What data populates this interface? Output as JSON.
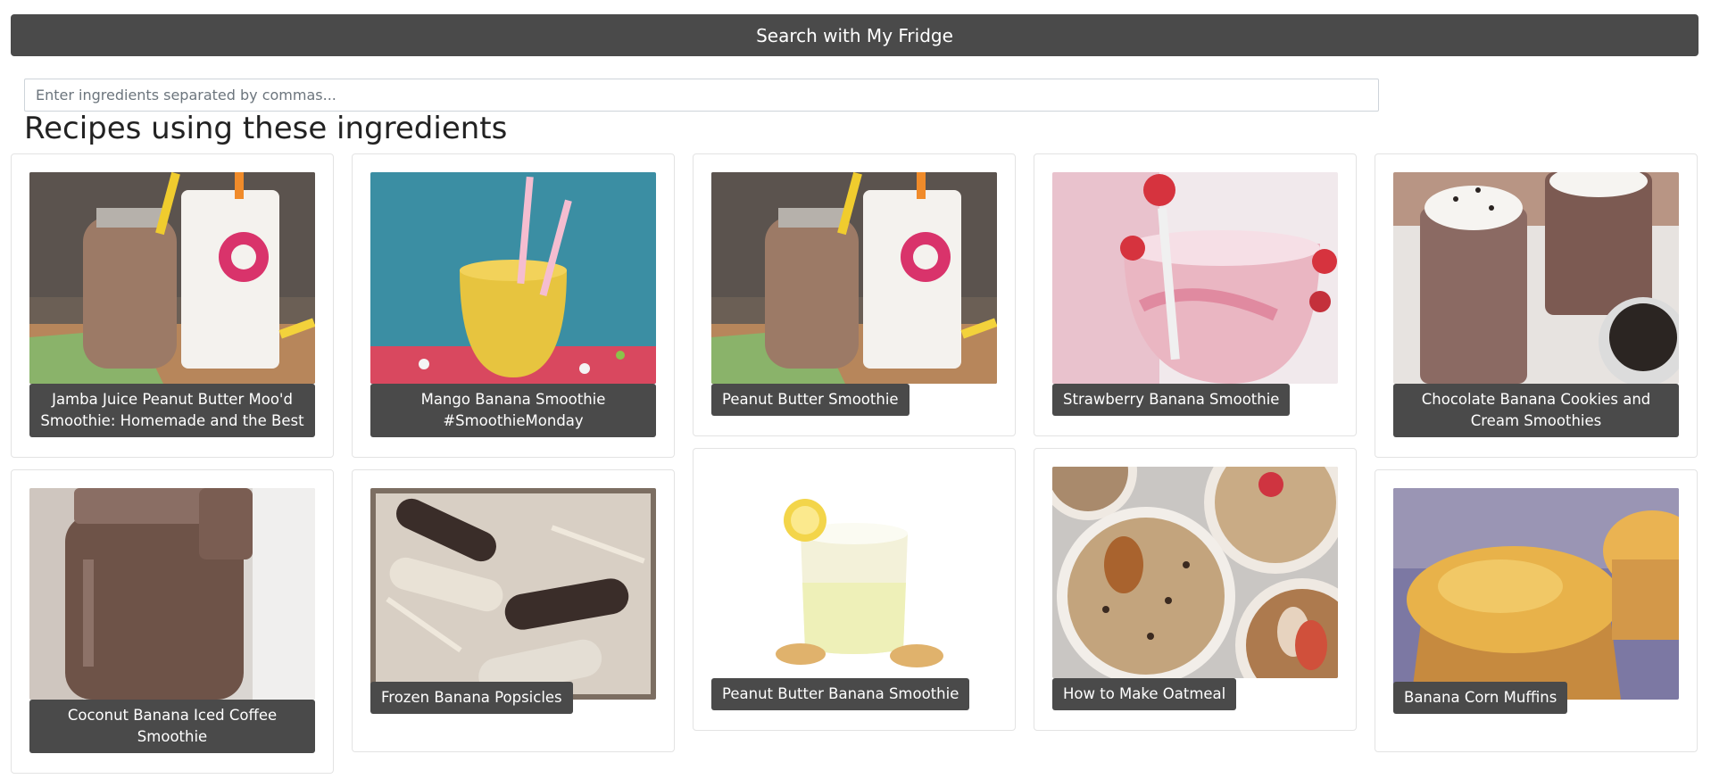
{
  "search_button_label": "Search with My Fridge",
  "ingredients_input": {
    "placeholder": "Enter ingredients separated by commas...",
    "value": ""
  },
  "section_title": "Recipes using these ingredients",
  "recipes": [
    {
      "title": "Jamba Juice Peanut Butter Moo'd Smoothie: Homemade and the Best",
      "image": "chocolate-smoothie-with-jamba-cups"
    },
    {
      "title": "Mango Banana Smoothie #SmoothieMonday",
      "image": "yellow-smoothie-with-pink-straws"
    },
    {
      "title": "Peanut Butter Smoothie",
      "image": "chocolate-smoothie-with-jamba-cups"
    },
    {
      "title": "Strawberry Banana Smoothie",
      "image": "pink-smoothie-with-strawberries"
    },
    {
      "title": "Chocolate Banana Cookies and Cream Smoothies",
      "image": "chocolate-smoothie-with-whipped-cream"
    },
    {
      "title": "Coconut Banana Iced Coffee Smoothie",
      "image": "brown-smoothie-in-mason-jar"
    },
    {
      "title": "Frozen Banana Popsicles",
      "image": "chocolate-dipped-banana-pops"
    },
    {
      "title": "Peanut Butter Banana Smoothie",
      "image": "pale-smoothie-with-lemon-slice"
    },
    {
      "title": "How to Make Oatmeal",
      "image": "oatmeal-bowls-with-toppings"
    },
    {
      "title": "Banana Corn Muffins",
      "image": "golden-corn-muffins"
    }
  ],
  "colors": {
    "button_bg": "#4a4a4a",
    "button_text": "#ffffff",
    "card_border": "#e3e3e3"
  }
}
